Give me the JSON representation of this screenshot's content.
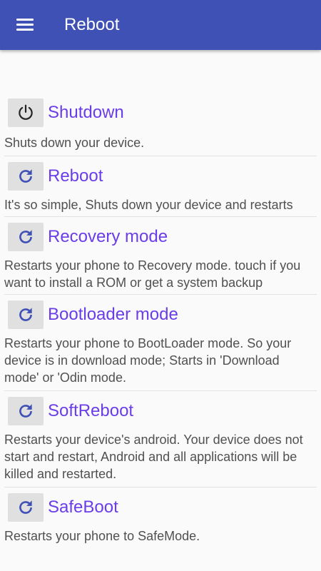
{
  "app": {
    "title": "Reboot",
    "accent": "#3f51b5",
    "item_color": "#6a3de8"
  },
  "items": [
    {
      "icon": "power-icon",
      "label": "Shutdown",
      "desc": "Shuts down your device."
    },
    {
      "icon": "refresh-icon",
      "label": "Reboot",
      "desc": "It's so simple, Shuts down your device and restarts"
    },
    {
      "icon": "refresh-icon",
      "label": "Recovery mode",
      "desc": "Restarts your phone to Recovery mode. touch if you want to install a ROM or get a system backup"
    },
    {
      "icon": "refresh-icon",
      "label": "Bootloader mode",
      "desc": "Restarts your phone to BootLoader mode. So your device is in download mode; Starts in 'Download mode' or 'Odin mode."
    },
    {
      "icon": "refresh-icon",
      "label": "SoftReboot",
      "desc": "Restarts your device's android. Your device does not start and restart, Android and all applications will be killed and restarted."
    },
    {
      "icon": "refresh-icon",
      "label": "SafeBoot",
      "desc": "Restarts your phone to SafeMode."
    }
  ]
}
